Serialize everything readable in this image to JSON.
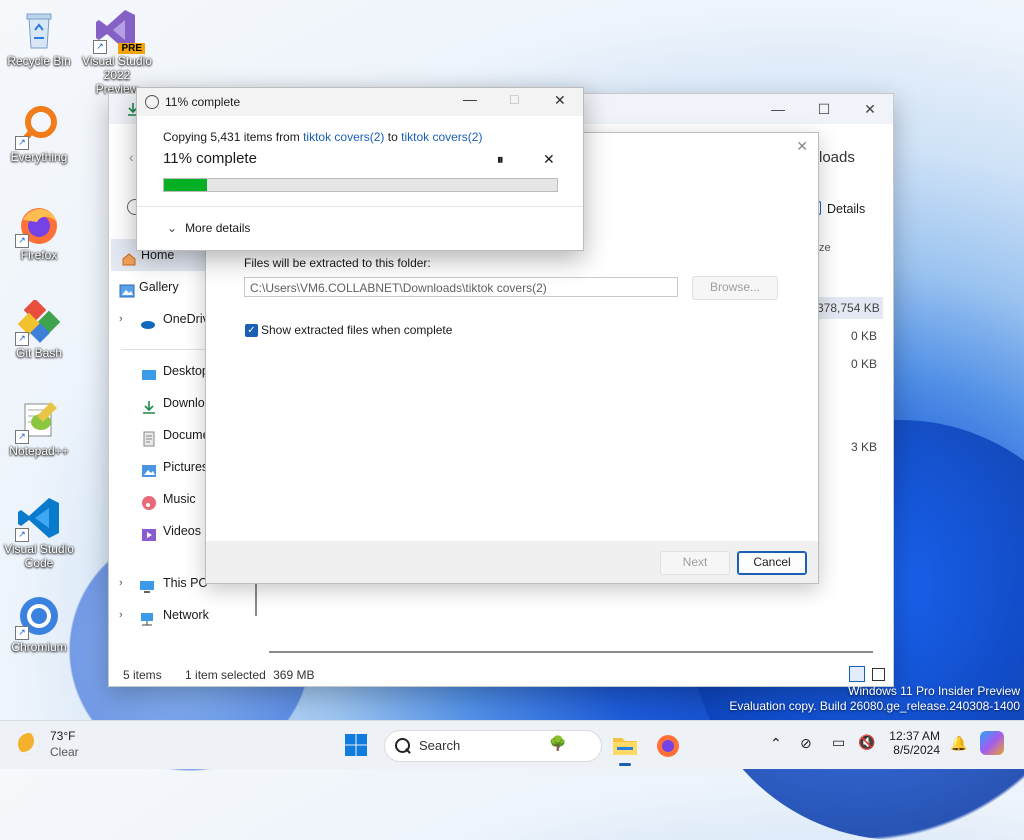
{
  "desktop": {
    "icons": [
      {
        "label": "Recycle Bin",
        "icon": "recycle-bin-icon"
      },
      {
        "label": "Visual Studio 2022 Preview",
        "badge": "PRE",
        "icon": "visual-studio-icon"
      },
      {
        "label": "Everything",
        "icon": "everything-search-icon"
      },
      {
        "label": "Firefox",
        "icon": "firefox-icon"
      },
      {
        "label": "Git Bash",
        "icon": "git-bash-icon"
      },
      {
        "label": "Notepad++",
        "icon": "notepad-plus-plus-icon"
      },
      {
        "label": "Visual Studio Code",
        "icon": "vscode-icon"
      },
      {
        "label": "Chromium",
        "icon": "chromium-icon"
      }
    ]
  },
  "explorer": {
    "header_right": "loads",
    "details_label": "Details",
    "size_header": "ze",
    "sizes": [
      "378,754 KB",
      "0 KB",
      "0 KB",
      "3 KB"
    ],
    "nav": [
      {
        "label": "Home",
        "selected": true
      },
      {
        "label": "Gallery"
      },
      {
        "label": "OneDriv",
        "expandable": true
      },
      {
        "label": "Desktop"
      },
      {
        "label": "Downlo"
      },
      {
        "label": "Docume"
      },
      {
        "label": "Pictures"
      },
      {
        "label": "Music"
      },
      {
        "label": "Videos"
      },
      {
        "label": "This PC",
        "expandable": true
      },
      {
        "label": "Network",
        "expandable": true
      }
    ],
    "status": {
      "items": "5 items",
      "selected": "1 item selected",
      "size": "369 MB"
    }
  },
  "wizard": {
    "folder_label": "Files will be extracted to this folder:",
    "folder_path": "C:\\Users\\VM6.COLLABNET\\Downloads\\tiktok covers(2)",
    "browse_label": "Browse...",
    "show_files_label": "Show extracted files when complete",
    "show_files_checked": true,
    "next_label": "Next",
    "cancel_label": "Cancel"
  },
  "copy_dialog": {
    "title": "11% complete",
    "copy_prefix": "Copying 5,431 items from ",
    "source": "tiktok covers(2)",
    "to_word": " to ",
    "dest": "tiktok covers(2)",
    "status": "11% complete",
    "progress": 0.11,
    "more_details": "More details"
  },
  "taskbar": {
    "weather_temp": "73°F",
    "weather_cond": "Clear",
    "search_placeholder": "Search",
    "time": "12:37 AM",
    "date": "8/5/2024"
  },
  "watermark": {
    "line1": "Windows 11 Pro Insider Preview",
    "line2": "Evaluation copy. Build 26080.ge_release.240308-1400"
  },
  "colors": {
    "accent": "#1b5fb4",
    "progress": "#06b025",
    "link": "#1a5fb4"
  }
}
